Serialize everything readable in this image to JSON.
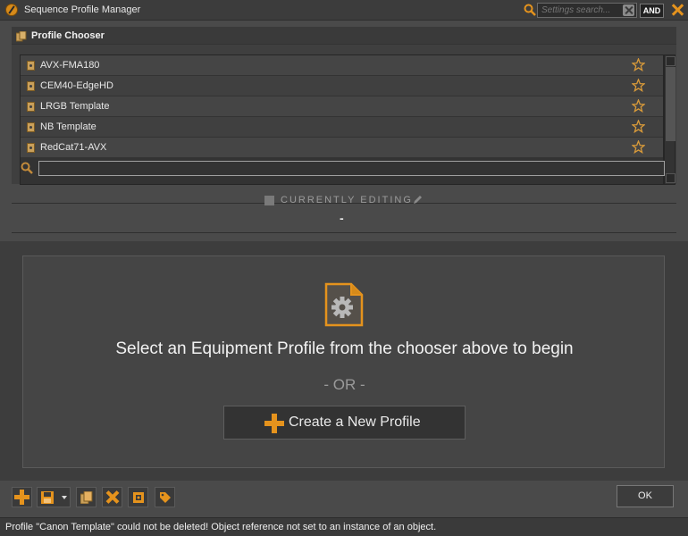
{
  "window": {
    "title": "Sequence Profile Manager"
  },
  "title_search": {
    "placeholder": "Settings search...",
    "mode_label": "AND"
  },
  "chooser": {
    "title": "Profile Chooser",
    "profiles": [
      {
        "name": "AVX-FMA180"
      },
      {
        "name": "CEM40-EdgeHD"
      },
      {
        "name": "LRGB Template"
      },
      {
        "name": "NB Template"
      },
      {
        "name": "RedCat71-AVX"
      }
    ],
    "search_value": ""
  },
  "editing": {
    "label": "CURRENTLY EDITING",
    "value": "-"
  },
  "main": {
    "message": "Select an Equipment Profile from the chooser above to begin",
    "or_text": "- OR -",
    "create_label": "Create a New Profile"
  },
  "footer": {
    "ok_label": "OK"
  },
  "status": {
    "text": "Profile \"Canon Template\" could not be deleted! Object reference not set to an instance of an object."
  },
  "colors": {
    "accent": "#e5931d",
    "background": "#4a4a4a"
  }
}
